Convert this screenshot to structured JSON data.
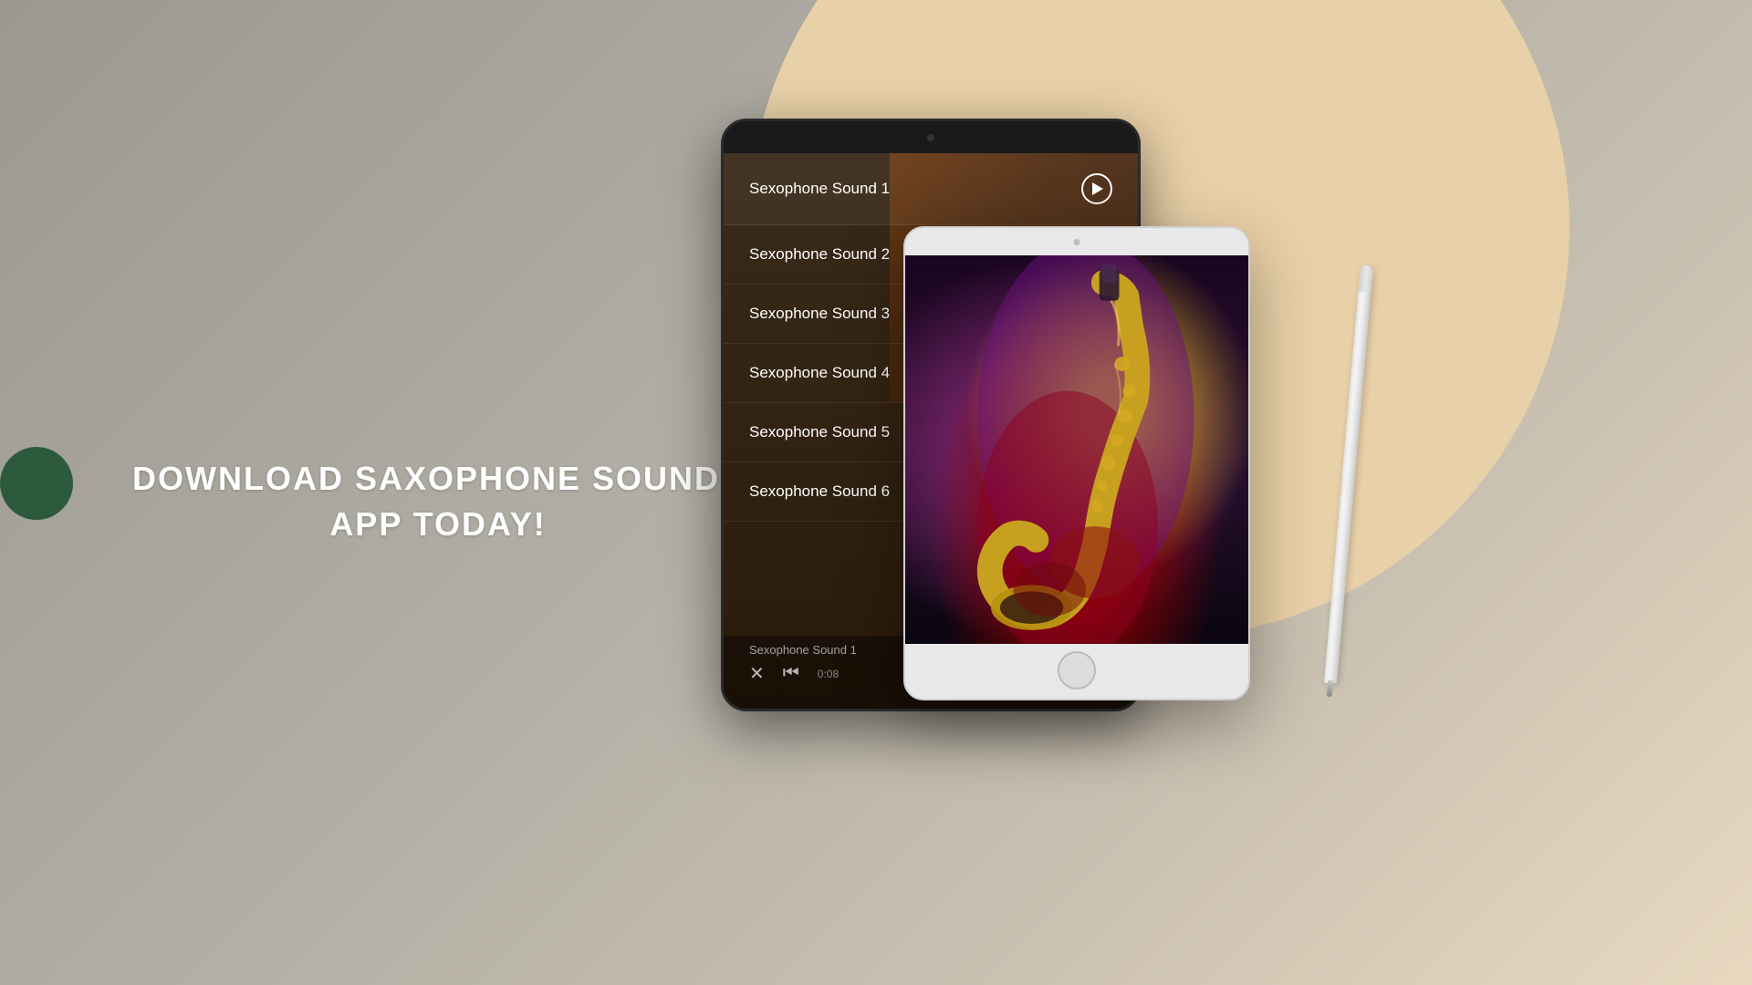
{
  "background": {
    "color": "#b8b4a8"
  },
  "hero": {
    "line1": "DOWNLOAD SAXOPHONE SOUNDS",
    "line2": "APP TODAY!"
  },
  "darkTablet": {
    "songs": [
      {
        "title": "Sexophone Sound 1",
        "hasPlayButton": true
      },
      {
        "title": "Sexophone Sound 2",
        "hasPlayButton": false
      },
      {
        "title": "Sexophone Sound 3",
        "hasPlayButton": false
      },
      {
        "title": "Sexophone Sound 4",
        "hasPlayButton": false
      },
      {
        "title": "Sexophone Sound 5",
        "hasPlayButton": false
      },
      {
        "title": "Sexophone Sound 6",
        "hasPlayButton": false
      }
    ],
    "player": {
      "currentTrack": "Sexophone Sound 1",
      "time": "0:08"
    }
  },
  "icons": {
    "shuffle": "⇄",
    "skipBack": "⏮",
    "playCircle": "▶"
  }
}
